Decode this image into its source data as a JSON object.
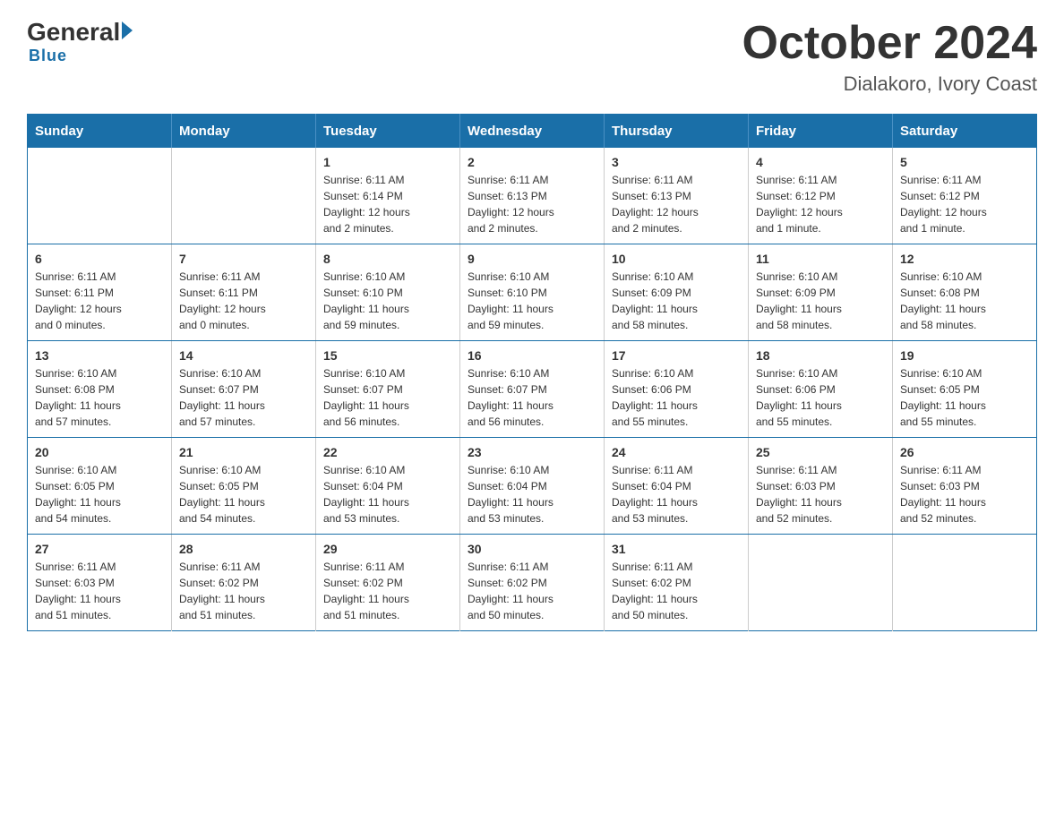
{
  "header": {
    "logo_general": "General",
    "logo_blue": "Blue",
    "month_title": "October 2024",
    "location": "Dialakoro, Ivory Coast"
  },
  "weekdays": [
    "Sunday",
    "Monday",
    "Tuesday",
    "Wednesday",
    "Thursday",
    "Friday",
    "Saturday"
  ],
  "weeks": [
    [
      {
        "day": "",
        "info": ""
      },
      {
        "day": "",
        "info": ""
      },
      {
        "day": "1",
        "info": "Sunrise: 6:11 AM\nSunset: 6:14 PM\nDaylight: 12 hours\nand 2 minutes."
      },
      {
        "day": "2",
        "info": "Sunrise: 6:11 AM\nSunset: 6:13 PM\nDaylight: 12 hours\nand 2 minutes."
      },
      {
        "day": "3",
        "info": "Sunrise: 6:11 AM\nSunset: 6:13 PM\nDaylight: 12 hours\nand 2 minutes."
      },
      {
        "day": "4",
        "info": "Sunrise: 6:11 AM\nSunset: 6:12 PM\nDaylight: 12 hours\nand 1 minute."
      },
      {
        "day": "5",
        "info": "Sunrise: 6:11 AM\nSunset: 6:12 PM\nDaylight: 12 hours\nand 1 minute."
      }
    ],
    [
      {
        "day": "6",
        "info": "Sunrise: 6:11 AM\nSunset: 6:11 PM\nDaylight: 12 hours\nand 0 minutes."
      },
      {
        "day": "7",
        "info": "Sunrise: 6:11 AM\nSunset: 6:11 PM\nDaylight: 12 hours\nand 0 minutes."
      },
      {
        "day": "8",
        "info": "Sunrise: 6:10 AM\nSunset: 6:10 PM\nDaylight: 11 hours\nand 59 minutes."
      },
      {
        "day": "9",
        "info": "Sunrise: 6:10 AM\nSunset: 6:10 PM\nDaylight: 11 hours\nand 59 minutes."
      },
      {
        "day": "10",
        "info": "Sunrise: 6:10 AM\nSunset: 6:09 PM\nDaylight: 11 hours\nand 58 minutes."
      },
      {
        "day": "11",
        "info": "Sunrise: 6:10 AM\nSunset: 6:09 PM\nDaylight: 11 hours\nand 58 minutes."
      },
      {
        "day": "12",
        "info": "Sunrise: 6:10 AM\nSunset: 6:08 PM\nDaylight: 11 hours\nand 58 minutes."
      }
    ],
    [
      {
        "day": "13",
        "info": "Sunrise: 6:10 AM\nSunset: 6:08 PM\nDaylight: 11 hours\nand 57 minutes."
      },
      {
        "day": "14",
        "info": "Sunrise: 6:10 AM\nSunset: 6:07 PM\nDaylight: 11 hours\nand 57 minutes."
      },
      {
        "day": "15",
        "info": "Sunrise: 6:10 AM\nSunset: 6:07 PM\nDaylight: 11 hours\nand 56 minutes."
      },
      {
        "day": "16",
        "info": "Sunrise: 6:10 AM\nSunset: 6:07 PM\nDaylight: 11 hours\nand 56 minutes."
      },
      {
        "day": "17",
        "info": "Sunrise: 6:10 AM\nSunset: 6:06 PM\nDaylight: 11 hours\nand 55 minutes."
      },
      {
        "day": "18",
        "info": "Sunrise: 6:10 AM\nSunset: 6:06 PM\nDaylight: 11 hours\nand 55 minutes."
      },
      {
        "day": "19",
        "info": "Sunrise: 6:10 AM\nSunset: 6:05 PM\nDaylight: 11 hours\nand 55 minutes."
      }
    ],
    [
      {
        "day": "20",
        "info": "Sunrise: 6:10 AM\nSunset: 6:05 PM\nDaylight: 11 hours\nand 54 minutes."
      },
      {
        "day": "21",
        "info": "Sunrise: 6:10 AM\nSunset: 6:05 PM\nDaylight: 11 hours\nand 54 minutes."
      },
      {
        "day": "22",
        "info": "Sunrise: 6:10 AM\nSunset: 6:04 PM\nDaylight: 11 hours\nand 53 minutes."
      },
      {
        "day": "23",
        "info": "Sunrise: 6:10 AM\nSunset: 6:04 PM\nDaylight: 11 hours\nand 53 minutes."
      },
      {
        "day": "24",
        "info": "Sunrise: 6:11 AM\nSunset: 6:04 PM\nDaylight: 11 hours\nand 53 minutes."
      },
      {
        "day": "25",
        "info": "Sunrise: 6:11 AM\nSunset: 6:03 PM\nDaylight: 11 hours\nand 52 minutes."
      },
      {
        "day": "26",
        "info": "Sunrise: 6:11 AM\nSunset: 6:03 PM\nDaylight: 11 hours\nand 52 minutes."
      }
    ],
    [
      {
        "day": "27",
        "info": "Sunrise: 6:11 AM\nSunset: 6:03 PM\nDaylight: 11 hours\nand 51 minutes."
      },
      {
        "day": "28",
        "info": "Sunrise: 6:11 AM\nSunset: 6:02 PM\nDaylight: 11 hours\nand 51 minutes."
      },
      {
        "day": "29",
        "info": "Sunrise: 6:11 AM\nSunset: 6:02 PM\nDaylight: 11 hours\nand 51 minutes."
      },
      {
        "day": "30",
        "info": "Sunrise: 6:11 AM\nSunset: 6:02 PM\nDaylight: 11 hours\nand 50 minutes."
      },
      {
        "day": "31",
        "info": "Sunrise: 6:11 AM\nSunset: 6:02 PM\nDaylight: 11 hours\nand 50 minutes."
      },
      {
        "day": "",
        "info": ""
      },
      {
        "day": "",
        "info": ""
      }
    ]
  ]
}
